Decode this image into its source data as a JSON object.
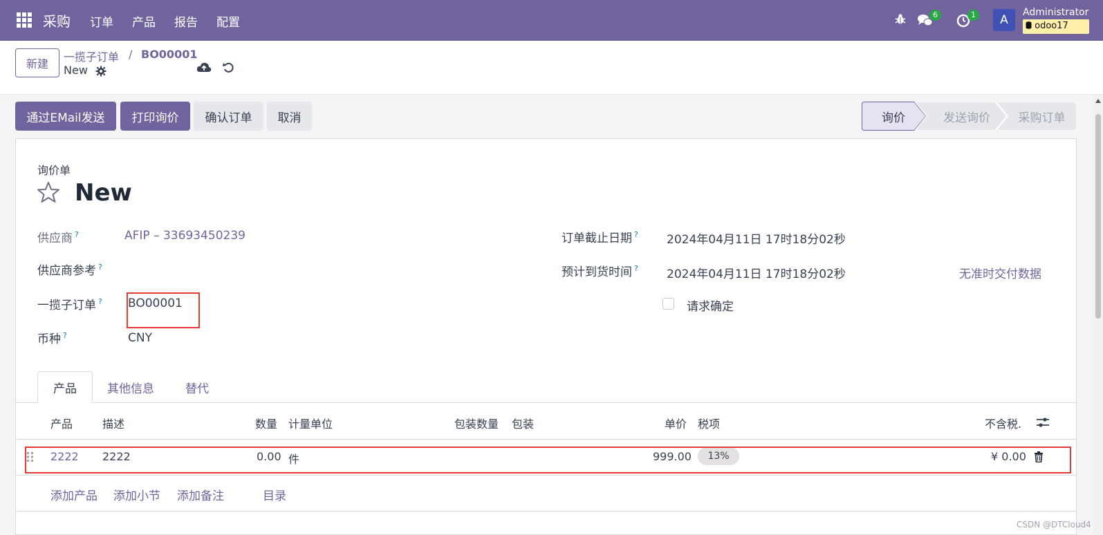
{
  "navbar": {
    "app_name": "采购",
    "menu": [
      "订单",
      "产品",
      "报告",
      "配置"
    ],
    "messages_count": "6",
    "activities_count": "1",
    "avatar_letter": "A",
    "user_name": "Administrator",
    "database": "odoo17"
  },
  "control_panel": {
    "new_button": "新建",
    "breadcrumb_parent": "一揽子订单",
    "breadcrumb_separator": "/",
    "breadcrumb_current": "BO00001",
    "record_name": "New"
  },
  "actions": {
    "send_email": "通过EMail发送",
    "print_rfq": "打印询价",
    "confirm_order": "确认订单",
    "cancel": "取消"
  },
  "status_bar": [
    "询价",
    "发送询价",
    "采购订单"
  ],
  "form": {
    "doc_type": "询价单",
    "title": "New",
    "tooltip_mark": "?",
    "fields": {
      "vendor_label": "供应商",
      "vendor_value": "AFIP – 33693450239",
      "vendor_ref_label": "供应商参考",
      "blanket_order_label": "一揽子订单",
      "blanket_order_value": "BO00001",
      "currency_label": "币种",
      "currency_value": "CNY",
      "order_deadline_label": "订单截止日期",
      "order_deadline_value": "2024年04月11日 17时18分02秒",
      "expected_arrival_label": "预计到货时间",
      "expected_arrival_value": "2024年04月11日 17时18分02秒",
      "no_ontime_data": "无准时交付数据",
      "ask_confirmation_label": "请求确定"
    }
  },
  "tabs": [
    "产品",
    "其他信息",
    "替代"
  ],
  "table": {
    "headers": {
      "product": "产品",
      "description": "描述",
      "quantity": "数量",
      "uom": "计量单位",
      "packaging_qty": "包装数量",
      "packaging": "包装",
      "unit_price": "单价",
      "taxes": "税项",
      "subtotal": "不含税."
    },
    "rows": [
      {
        "product": "2222",
        "description": "2222",
        "quantity": "0.00",
        "uom": "件",
        "unit_price": "999.00",
        "tax": "13%",
        "subtotal": "¥ 0.00"
      }
    ],
    "add_product": "添加产品",
    "add_section": "添加小节",
    "add_note": "添加备注",
    "catalog": "目录"
  },
  "watermark": "CSDN @DTCloud4",
  "colors": {
    "brand": "#71639e",
    "highlight": "#e53935"
  }
}
